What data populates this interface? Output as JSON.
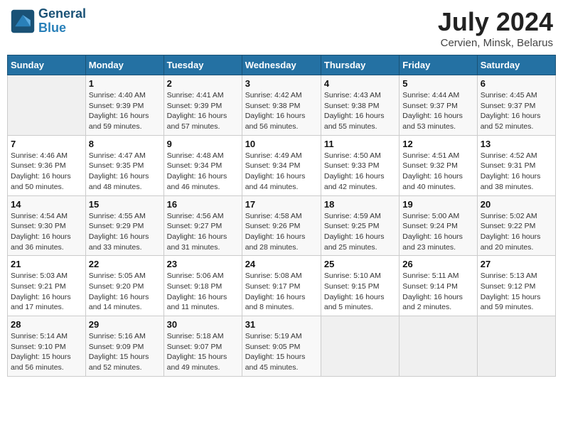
{
  "header": {
    "logo_line1": "General",
    "logo_line2": "Blue",
    "month": "July 2024",
    "location": "Cervien, Minsk, Belarus"
  },
  "columns": [
    "Sunday",
    "Monday",
    "Tuesday",
    "Wednesday",
    "Thursday",
    "Friday",
    "Saturday"
  ],
  "weeks": [
    [
      {
        "day": "",
        "info": ""
      },
      {
        "day": "1",
        "info": "Sunrise: 4:40 AM\nSunset: 9:39 PM\nDaylight: 16 hours\nand 59 minutes."
      },
      {
        "day": "2",
        "info": "Sunrise: 4:41 AM\nSunset: 9:39 PM\nDaylight: 16 hours\nand 57 minutes."
      },
      {
        "day": "3",
        "info": "Sunrise: 4:42 AM\nSunset: 9:38 PM\nDaylight: 16 hours\nand 56 minutes."
      },
      {
        "day": "4",
        "info": "Sunrise: 4:43 AM\nSunset: 9:38 PM\nDaylight: 16 hours\nand 55 minutes."
      },
      {
        "day": "5",
        "info": "Sunrise: 4:44 AM\nSunset: 9:37 PM\nDaylight: 16 hours\nand 53 minutes."
      },
      {
        "day": "6",
        "info": "Sunrise: 4:45 AM\nSunset: 9:37 PM\nDaylight: 16 hours\nand 52 minutes."
      }
    ],
    [
      {
        "day": "7",
        "info": "Sunrise: 4:46 AM\nSunset: 9:36 PM\nDaylight: 16 hours\nand 50 minutes."
      },
      {
        "day": "8",
        "info": "Sunrise: 4:47 AM\nSunset: 9:35 PM\nDaylight: 16 hours\nand 48 minutes."
      },
      {
        "day": "9",
        "info": "Sunrise: 4:48 AM\nSunset: 9:34 PM\nDaylight: 16 hours\nand 46 minutes."
      },
      {
        "day": "10",
        "info": "Sunrise: 4:49 AM\nSunset: 9:34 PM\nDaylight: 16 hours\nand 44 minutes."
      },
      {
        "day": "11",
        "info": "Sunrise: 4:50 AM\nSunset: 9:33 PM\nDaylight: 16 hours\nand 42 minutes."
      },
      {
        "day": "12",
        "info": "Sunrise: 4:51 AM\nSunset: 9:32 PM\nDaylight: 16 hours\nand 40 minutes."
      },
      {
        "day": "13",
        "info": "Sunrise: 4:52 AM\nSunset: 9:31 PM\nDaylight: 16 hours\nand 38 minutes."
      }
    ],
    [
      {
        "day": "14",
        "info": "Sunrise: 4:54 AM\nSunset: 9:30 PM\nDaylight: 16 hours\nand 36 minutes."
      },
      {
        "day": "15",
        "info": "Sunrise: 4:55 AM\nSunset: 9:29 PM\nDaylight: 16 hours\nand 33 minutes."
      },
      {
        "day": "16",
        "info": "Sunrise: 4:56 AM\nSunset: 9:27 PM\nDaylight: 16 hours\nand 31 minutes."
      },
      {
        "day": "17",
        "info": "Sunrise: 4:58 AM\nSunset: 9:26 PM\nDaylight: 16 hours\nand 28 minutes."
      },
      {
        "day": "18",
        "info": "Sunrise: 4:59 AM\nSunset: 9:25 PM\nDaylight: 16 hours\nand 25 minutes."
      },
      {
        "day": "19",
        "info": "Sunrise: 5:00 AM\nSunset: 9:24 PM\nDaylight: 16 hours\nand 23 minutes."
      },
      {
        "day": "20",
        "info": "Sunrise: 5:02 AM\nSunset: 9:22 PM\nDaylight: 16 hours\nand 20 minutes."
      }
    ],
    [
      {
        "day": "21",
        "info": "Sunrise: 5:03 AM\nSunset: 9:21 PM\nDaylight: 16 hours\nand 17 minutes."
      },
      {
        "day": "22",
        "info": "Sunrise: 5:05 AM\nSunset: 9:20 PM\nDaylight: 16 hours\nand 14 minutes."
      },
      {
        "day": "23",
        "info": "Sunrise: 5:06 AM\nSunset: 9:18 PM\nDaylight: 16 hours\nand 11 minutes."
      },
      {
        "day": "24",
        "info": "Sunrise: 5:08 AM\nSunset: 9:17 PM\nDaylight: 16 hours\nand 8 minutes."
      },
      {
        "day": "25",
        "info": "Sunrise: 5:10 AM\nSunset: 9:15 PM\nDaylight: 16 hours\nand 5 minutes."
      },
      {
        "day": "26",
        "info": "Sunrise: 5:11 AM\nSunset: 9:14 PM\nDaylight: 16 hours\nand 2 minutes."
      },
      {
        "day": "27",
        "info": "Sunrise: 5:13 AM\nSunset: 9:12 PM\nDaylight: 15 hours\nand 59 minutes."
      }
    ],
    [
      {
        "day": "28",
        "info": "Sunrise: 5:14 AM\nSunset: 9:10 PM\nDaylight: 15 hours\nand 56 minutes."
      },
      {
        "day": "29",
        "info": "Sunrise: 5:16 AM\nSunset: 9:09 PM\nDaylight: 15 hours\nand 52 minutes."
      },
      {
        "day": "30",
        "info": "Sunrise: 5:18 AM\nSunset: 9:07 PM\nDaylight: 15 hours\nand 49 minutes."
      },
      {
        "day": "31",
        "info": "Sunrise: 5:19 AM\nSunset: 9:05 PM\nDaylight: 15 hours\nand 45 minutes."
      },
      {
        "day": "",
        "info": ""
      },
      {
        "day": "",
        "info": ""
      },
      {
        "day": "",
        "info": ""
      }
    ]
  ]
}
